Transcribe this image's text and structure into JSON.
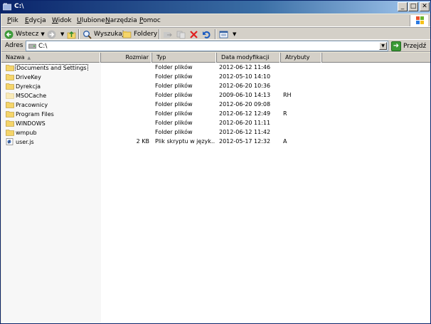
{
  "window": {
    "title": "C:\\"
  },
  "title_buttons": {
    "minimize": "_",
    "maximize": "□",
    "close": "✕"
  },
  "menu": [
    {
      "label": "Plik",
      "accel": "P",
      "rest": "lik"
    },
    {
      "label": "Edycja",
      "accel": "E",
      "rest": "dycja"
    },
    {
      "label": "Widok",
      "accel": "W",
      "rest": "idok"
    },
    {
      "label": "Ulubione",
      "accel": "U",
      "rest": "lubione"
    },
    {
      "label": "Narzędzia",
      "accel": "N",
      "rest": "arzędzia"
    },
    {
      "label": "Pomoc",
      "accel": "P",
      "rest": "omoc"
    }
  ],
  "toolbar": {
    "back_label": "Wstecz",
    "search_label": "Wyszukaj",
    "folders_label": "Foldery"
  },
  "address": {
    "label": "Adres",
    "value": "C:\\",
    "go_label": "Przejdź"
  },
  "list": {
    "columns": {
      "name": "Nazwa",
      "size": "Rozmiar",
      "type": "Typ",
      "date": "Data modyfikacji",
      "attr": "Atrybuty"
    },
    "rows": [
      {
        "name": "Documents and Settings",
        "size": "",
        "type": "Folder plików",
        "date": "2012-06-12 11:46",
        "attr": "",
        "icon": "folder-icon"
      },
      {
        "name": "DriveKey",
        "size": "",
        "type": "Folder plików",
        "date": "2012-05-10 14:10",
        "attr": "",
        "icon": "folder-icon"
      },
      {
        "name": "Dyrekcja",
        "size": "",
        "type": "Folder plików",
        "date": "2012-06-20 10:36",
        "attr": "",
        "icon": "folder-icon"
      },
      {
        "name": "MSOCache",
        "size": "",
        "type": "Folder plików",
        "date": "2009-06-10 14:13",
        "attr": "RH",
        "icon": "hidden-folder-icon"
      },
      {
        "name": "Pracownicy",
        "size": "",
        "type": "Folder plików",
        "date": "2012-06-20 09:08",
        "attr": "",
        "icon": "folder-icon"
      },
      {
        "name": "Program Files",
        "size": "",
        "type": "Folder plików",
        "date": "2012-06-12 12:49",
        "attr": "R",
        "icon": "folder-icon"
      },
      {
        "name": "WINDOWS",
        "size": "",
        "type": "Folder plików",
        "date": "2012-06-20 11:11",
        "attr": "",
        "icon": "folder-icon"
      },
      {
        "name": "wmpub",
        "size": "",
        "type": "Folder plików",
        "date": "2012-06-12 11:42",
        "attr": "",
        "icon": "folder-icon"
      },
      {
        "name": "user.js",
        "size": "2 KB",
        "type": "Plik skryptu w język…",
        "date": "2012-05-17 12:32",
        "attr": "A",
        "icon": "script-file-icon"
      }
    ]
  },
  "colors": {
    "titlebar": "#0a246a",
    "chrome": "#d4d0c8",
    "folder": "#f5d56a"
  }
}
